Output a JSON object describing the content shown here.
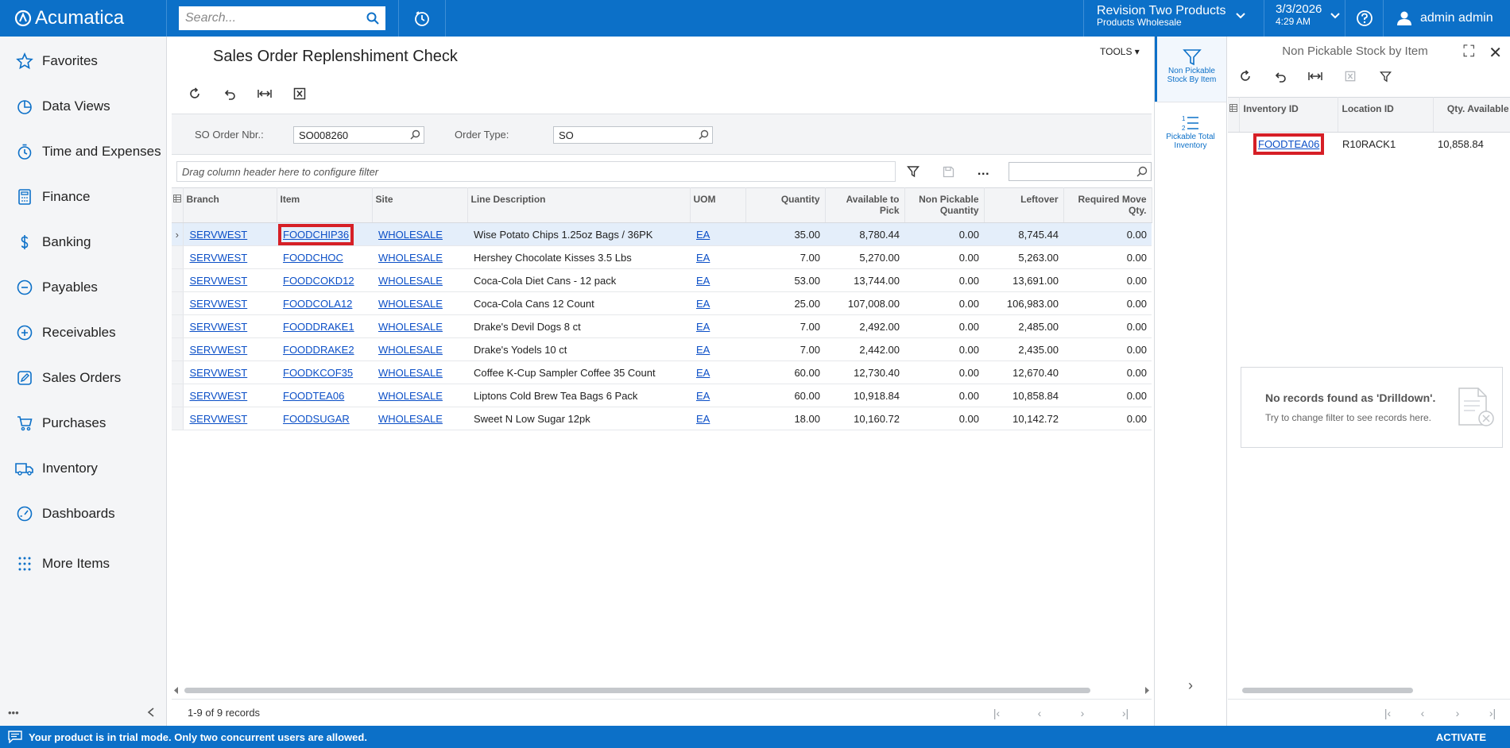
{
  "header": {
    "brand": "Acumatica",
    "search_placeholder": "Search...",
    "tenant_line1": "Revision Two Products",
    "tenant_line2": "Products Wholesale",
    "date": "3/3/2026",
    "time": "4:29 AM",
    "user": "admin admin",
    "accent_color": "#0c70c8"
  },
  "sidebar": {
    "items": [
      {
        "label": "Favorites",
        "icon": "star-icon"
      },
      {
        "label": "Data Views",
        "icon": "pie-chart-icon"
      },
      {
        "label": "Time and Expenses",
        "icon": "stopwatch-icon"
      },
      {
        "label": "Finance",
        "icon": "calculator-icon"
      },
      {
        "label": "Banking",
        "icon": "dollar-icon"
      },
      {
        "label": "Payables",
        "icon": "minus-circle-icon"
      },
      {
        "label": "Receivables",
        "icon": "plus-circle-icon"
      },
      {
        "label": "Sales Orders",
        "icon": "edit-icon"
      },
      {
        "label": "Purchases",
        "icon": "cart-icon"
      },
      {
        "label": "Inventory",
        "icon": "truck-icon"
      },
      {
        "label": "Dashboards",
        "icon": "gauge-icon"
      },
      {
        "label": "More Items",
        "icon": "grid-dots-icon"
      }
    ]
  },
  "page": {
    "title": "Sales Order Replenshiment Check",
    "tools_label": "TOOLS"
  },
  "form": {
    "so_order_label": "SO Order Nbr.:",
    "so_order_value": "SO008260",
    "order_type_label": "Order Type:",
    "order_type_value": "SO"
  },
  "grid": {
    "filter_placeholder": "Drag column header here to configure filter",
    "columns": {
      "branch": "Branch",
      "item": "Item",
      "site": "Site",
      "line_description": "Line Description",
      "uom": "UOM",
      "quantity": "Quantity",
      "available_to_pick": "Available to Pick",
      "non_pickable_qty": "Non Pickable Quantity",
      "leftover": "Leftover",
      "required_move_qty": "Required Move Qty."
    },
    "rows": [
      {
        "branch": "SERVWEST",
        "item": "FOODCHIP36",
        "site": "WHOLESALE",
        "desc": "Wise Potato Chips 1.25oz Bags / 36PK",
        "uom": "EA",
        "qty": "35.00",
        "avail": "8,780.44",
        "nonpick": "0.00",
        "leftover": "8,745.44",
        "req": "0.00"
      },
      {
        "branch": "SERVWEST",
        "item": "FOODCHOC",
        "site": "WHOLESALE",
        "desc": "Hershey Chocolate Kisses 3.5 Lbs",
        "uom": "EA",
        "qty": "7.00",
        "avail": "5,270.00",
        "nonpick": "0.00",
        "leftover": "5,263.00",
        "req": "0.00"
      },
      {
        "branch": "SERVWEST",
        "item": "FOODCOKD12",
        "site": "WHOLESALE",
        "desc": "Coca-Cola Diet Cans - 12 pack",
        "uom": "EA",
        "qty": "53.00",
        "avail": "13,744.00",
        "nonpick": "0.00",
        "leftover": "13,691.00",
        "req": "0.00"
      },
      {
        "branch": "SERVWEST",
        "item": "FOODCOLA12",
        "site": "WHOLESALE",
        "desc": "Coca-Cola Cans 12 Count",
        "uom": "EA",
        "qty": "25.00",
        "avail": "107,008.00",
        "nonpick": "0.00",
        "leftover": "106,983.00",
        "req": "0.00"
      },
      {
        "branch": "SERVWEST",
        "item": "FOODDRAKE1",
        "site": "WHOLESALE",
        "desc": "Drake's Devil Dogs 8 ct",
        "uom": "EA",
        "qty": "7.00",
        "avail": "2,492.00",
        "nonpick": "0.00",
        "leftover": "2,485.00",
        "req": "0.00"
      },
      {
        "branch": "SERVWEST",
        "item": "FOODDRAKE2",
        "site": "WHOLESALE",
        "desc": "Drake's Yodels 10 ct",
        "uom": "EA",
        "qty": "7.00",
        "avail": "2,442.00",
        "nonpick": "0.00",
        "leftover": "2,435.00",
        "req": "0.00"
      },
      {
        "branch": "SERVWEST",
        "item": "FOODKCOF35",
        "site": "WHOLESALE",
        "desc": "Coffee K-Cup Sampler Coffee 35 Count",
        "uom": "EA",
        "qty": "60.00",
        "avail": "12,730.40",
        "nonpick": "0.00",
        "leftover": "12,670.40",
        "req": "0.00"
      },
      {
        "branch": "SERVWEST",
        "item": "FOODTEA06",
        "site": "WHOLESALE",
        "desc": "Liptons Cold Brew Tea Bags 6 Pack",
        "uom": "EA",
        "qty": "60.00",
        "avail": "10,918.84",
        "nonpick": "0.00",
        "leftover": "10,858.84",
        "req": "0.00"
      },
      {
        "branch": "SERVWEST",
        "item": "FOODSUGAR",
        "site": "WHOLESALE",
        "desc": "Sweet N Low Sugar 12pk",
        "uom": "EA",
        "qty": "18.00",
        "avail": "10,160.72",
        "nonpick": "0.00",
        "leftover": "10,142.72",
        "req": "0.00"
      }
    ],
    "record_count": "1-9 of 9 records"
  },
  "side_tabs": [
    {
      "label": "Non Pickable Stock By Item",
      "icon": "filter-icon"
    },
    {
      "label": "Pickable Total Inventory",
      "icon": "numbered-list-icon"
    }
  ],
  "right_pane": {
    "title": "Non Pickable Stock by Item",
    "columns": {
      "inventory_id": "Inventory ID",
      "location_id": "Location ID",
      "qty_available": "Qty. Available"
    },
    "rows": [
      {
        "inventory_id": "FOODTEA06",
        "location_id": "R10RACK1",
        "qty": "10,858.84"
      }
    ],
    "empty_title": "No records found as 'Drilldown'.",
    "empty_hint": "Try to change filter to see records here."
  },
  "status": {
    "message": "Your product is in trial mode. Only two concurrent users are allowed.",
    "action": "ACTIVATE"
  }
}
